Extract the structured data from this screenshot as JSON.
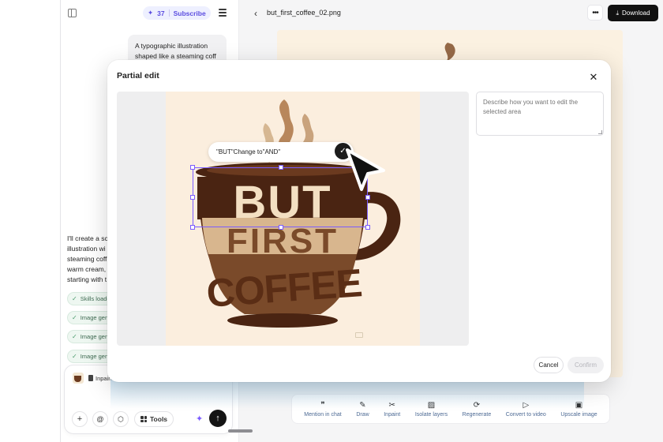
{
  "sidebar": {
    "credits": "37",
    "subscribe_label": "Subscribe",
    "user_message": "A typographic illustration shaped like a steaming coff",
    "assistant_message": "I'll create a sc illustration wi steaming coff warm cream, starting with t",
    "steps": [
      {
        "label": "Skills loade"
      },
      {
        "label": "Image gene"
      },
      {
        "label": "Image gene"
      },
      {
        "label": "Image gene"
      }
    ]
  },
  "composer": {
    "attachment_label": "Inpaint",
    "tools_label": "Tools"
  },
  "topbar": {
    "file_name": "but_first_coffee_02.png",
    "download_label": "Download"
  },
  "toolbar": {
    "items": [
      {
        "label": "Mention in chat",
        "icon": "quote-icon"
      },
      {
        "label": "Draw",
        "icon": "pen-icon"
      },
      {
        "label": "Inpaint",
        "icon": "scissors-icon"
      },
      {
        "label": "Isolate layers",
        "icon": "layers-icon"
      },
      {
        "label": "Regenerate",
        "icon": "refresh-icon"
      },
      {
        "label": "Convert to video",
        "icon": "play-icon"
      },
      {
        "label": "Upscale image",
        "icon": "hd-icon"
      }
    ]
  },
  "modal": {
    "title": "Partial edit",
    "edit_prompt": "\"BUT\"Change to\"AND\"",
    "textarea_placeholder": "Describe how you want to edit the selected area",
    "cancel_label": "Cancel",
    "confirm_label": "Confirm"
  },
  "artwork": {
    "word_1": "BUT",
    "word_2": "FIRST",
    "word_3": "COFFEE"
  },
  "colors": {
    "accent": "#7b5cff",
    "dark_brown": "#4a2412",
    "mid_brown": "#7a4a2a",
    "light_brown": "#c9a37d",
    "cream": "#fbeede"
  }
}
